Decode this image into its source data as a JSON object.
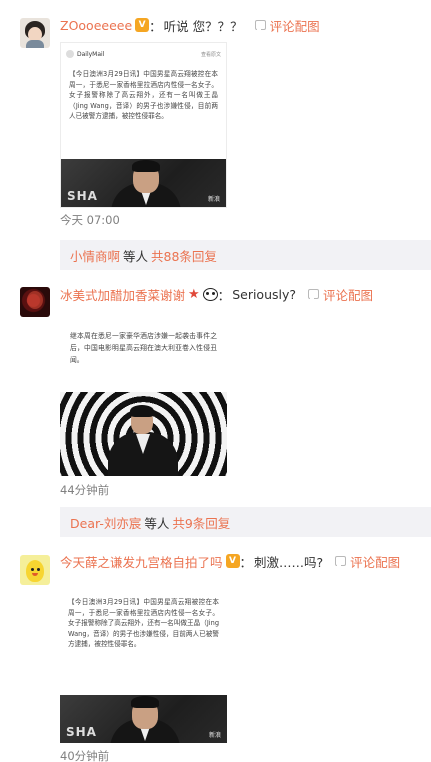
{
  "comments": [
    {
      "username": "ZOooeeeee",
      "badge": "V",
      "colon": "：",
      "text": "听说 您？？？",
      "repost_label": "评论配图",
      "image": {
        "source": "DailyMail",
        "more": "查看原文",
        "paragraph": "【今日澳洲3月29日讯】中国男星高云翔被控在本周一，于悉尼一家香格里拉酒店内性侵一名女子。女子报警称除了高云翔外，还有一名叫做王晶（Jing Wang，音译）的男子也涉嫌性侵，目前两人已被警方逮捕，被控性侵罪名。",
        "brand": "SHA",
        "watermark": "新浪"
      },
      "time": "今天 07:00"
    },
    {
      "username": "冰美式加醋加香菜谢谢",
      "colon": "：",
      "text": "Seriously?",
      "repost_label": "评论配图",
      "image": {
        "paragraph": "继本周在悉尼一家豪华酒店涉嫌一起袭击事件之后，中国电影明星高云翔在澳大利亚卷入性侵丑闻。"
      },
      "time": "44分钟前"
    },
    {
      "username": "今天薛之谦发九宫格自拍了吗",
      "badge": "V",
      "colon": "：",
      "text": "刺激……吗?",
      "repost_label": "评论配图",
      "image": {
        "paragraph": "【今日澳洲3月29日讯】中国男星高云翔被控在本周一，于悉尼一家香格里拉酒店内性侵一名女子。女子报警称除了高云翔外，还有一名叫做王晶（Jing Wang，音译）的男子也涉嫌性侵，目前两人已被警方逮捕，被控性侵罪名。",
        "brand": "SHA",
        "watermark": "新浪"
      },
      "time": "40分钟前"
    }
  ],
  "replies": [
    {
      "user": "小情商啊",
      "mid": "等人",
      "count": "共88条回复"
    },
    {
      "user": "Dear-刘亦宸",
      "mid": "等人",
      "count": "共9条回复"
    }
  ],
  "colors": {
    "accent": "#eb7350",
    "reply_bg": "#f2f2f5",
    "time": "#808080"
  },
  "icons": [
    "vip-badge-icon",
    "star-icon",
    "panda-emoji-icon",
    "repost-image-icon"
  ]
}
